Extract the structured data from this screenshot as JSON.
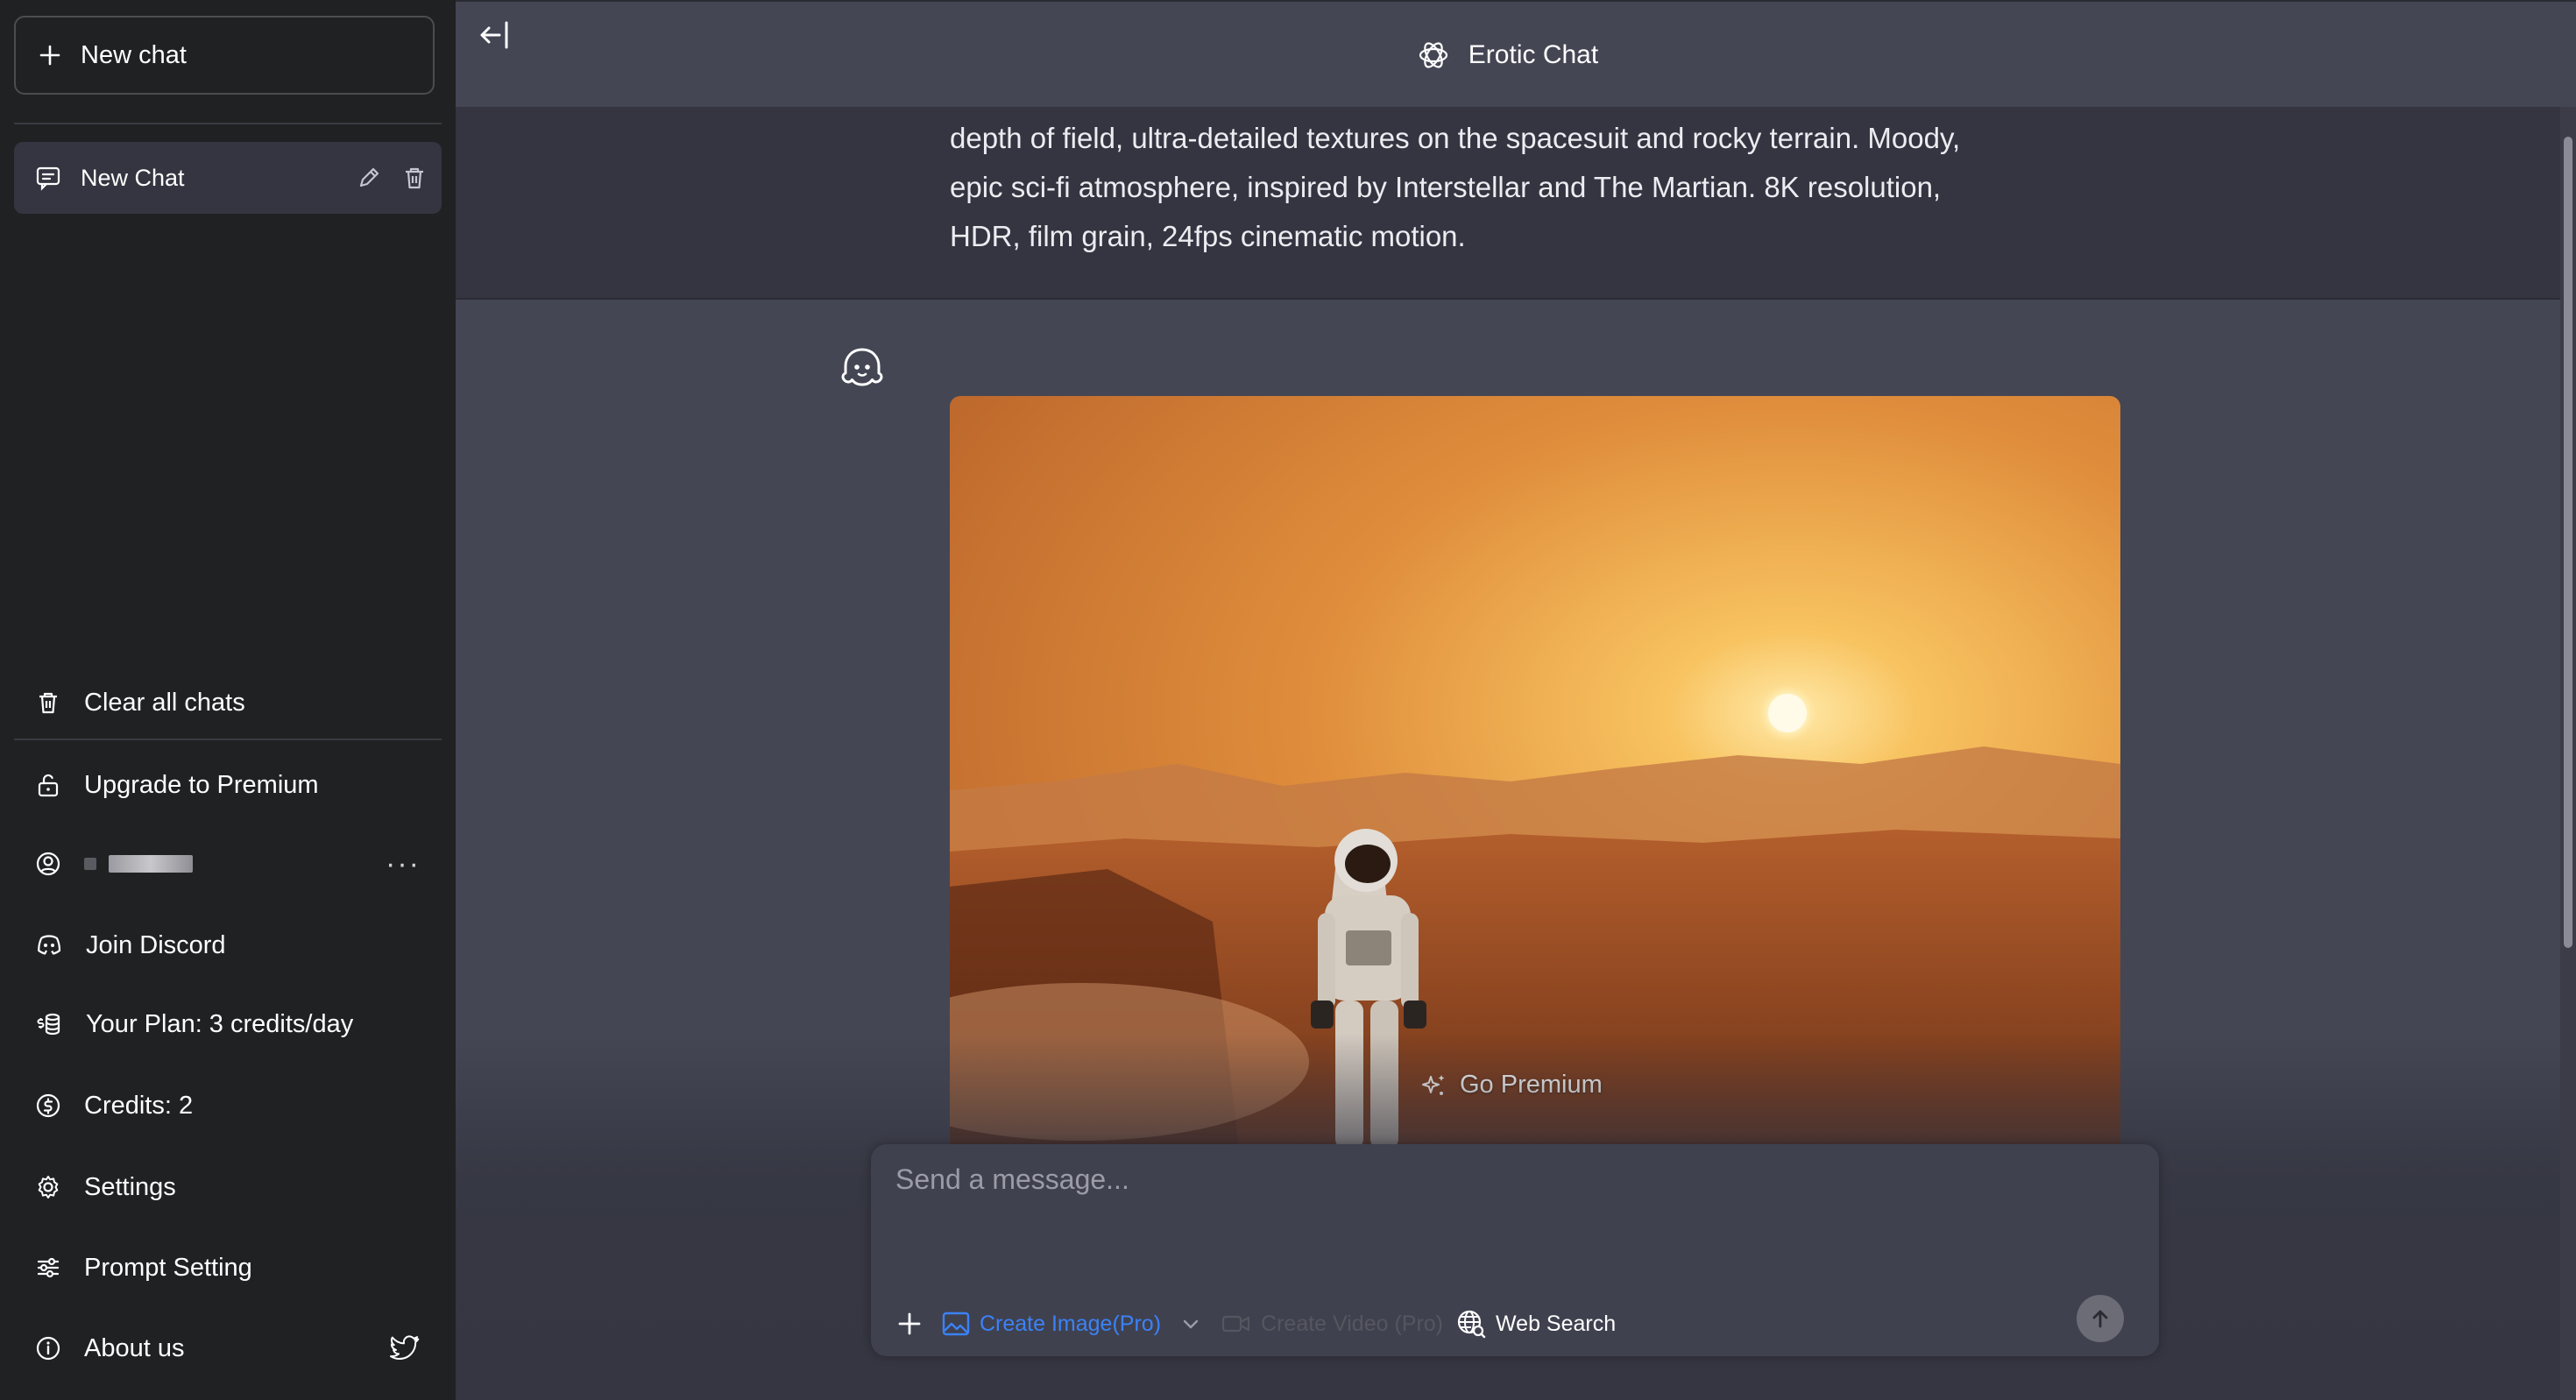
{
  "sidebar": {
    "new_chat_label": "New chat",
    "chats": [
      {
        "title": "New Chat"
      }
    ],
    "menu": {
      "clear_chats": "Clear all chats",
      "upgrade": "Upgrade to Premium",
      "user_more": "···",
      "join_discord": "Join Discord",
      "plan": "Your Plan: 3 credits/day",
      "credits": "Credits: 2",
      "settings": "Settings",
      "prompt_setting": "Prompt Setting",
      "about": "About us"
    }
  },
  "header": {
    "title": "Erotic Chat"
  },
  "conversation": {
    "previous_message_text": "depth of field, ultra-detailed textures on the spacesuit and rocky terrain. Moody, epic sci-fi atmosphere, inspired by Interstellar and The Martian. 8K resolution, HDR, film grain, 24fps cinematic motion.",
    "premium_badge": "Go Premium"
  },
  "composer": {
    "placeholder": "Send a message...",
    "tools": {
      "create_image": "Create Image(Pro)",
      "create_video": "Create Video (Pro)",
      "web_search": "Web Search"
    }
  },
  "colors": {
    "sidebar_bg": "#202123",
    "main_bg": "#444654",
    "message_bg": "#343541",
    "accent_blue": "#3b82f6"
  },
  "icons": {
    "new_chat": "plus-icon",
    "chat": "chat-bubble-icon",
    "edit": "pencil-icon",
    "delete": "trash-icon",
    "upgrade": "unlock-icon",
    "user": "user-circle-icon",
    "discord": "discord-icon",
    "plan": "coins-icon",
    "credits": "dollar-circle-icon",
    "settings": "gear-icon",
    "prompt": "sliders-icon",
    "about": "info-icon",
    "twitter": "twitter-icon",
    "collapse": "arrow-left-bar-icon",
    "brand": "openai-logo-icon",
    "bot": "ghost-icon",
    "sparkle": "sparkle-icon",
    "send": "arrow-up-icon",
    "globe": "globe-search-icon"
  }
}
